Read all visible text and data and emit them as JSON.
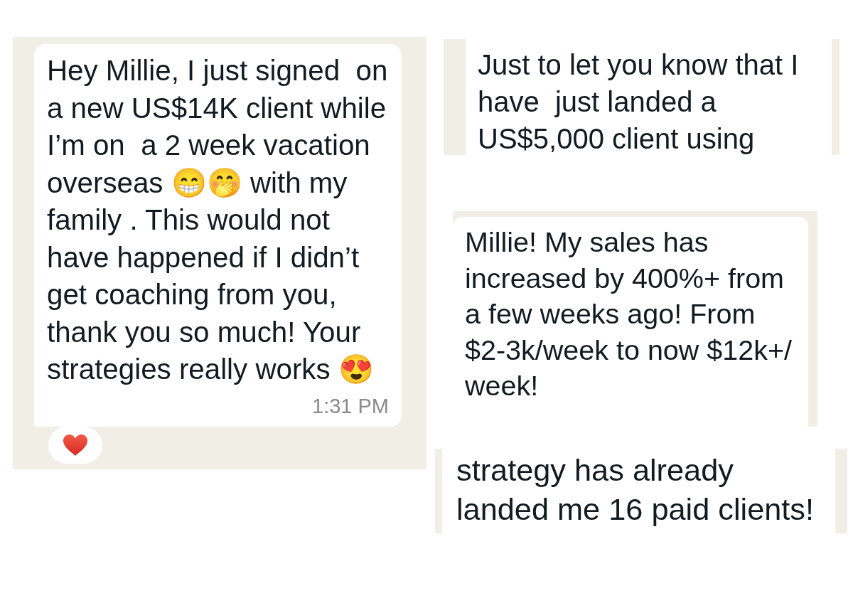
{
  "main_chat": {
    "message": {
      "lines": [
        "Hey Millie, I just signed  on",
        "a new US$14K client while",
        "I’m on  a 2 week vacation",
        "overseas 😁️🤭️ with my",
        "family . This would not",
        "have happened if I didn’t",
        "get coaching from you,",
        "thank you so much! Your",
        "strategies really works 😍️"
      ],
      "time": "1:31 PM"
    },
    "reaction": {
      "kind": "heart"
    }
  },
  "fragments": [
    {
      "kind": "strip",
      "lines": [
        "Just to let you know that I",
        "have  just landed a",
        "US$5,000 client using"
      ]
    },
    {
      "kind": "bubble",
      "lines": [
        "Millie! My sales has",
        "increased by 400%+ from",
        "a few weeks ago! From",
        "$2-3k/week to now $12k+/",
        "week!"
      ]
    },
    {
      "kind": "strip",
      "lines": [
        "strategy has already",
        "landed me 16 paid clients!"
      ]
    }
  ]
}
